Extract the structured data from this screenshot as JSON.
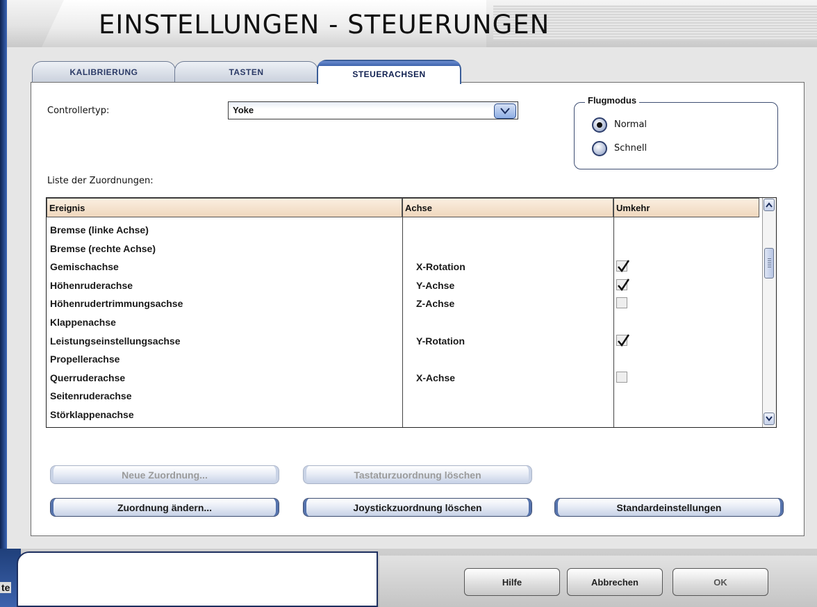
{
  "window": {
    "title": "EINSTELLUNGEN - STEUERUNGEN"
  },
  "tabs": [
    {
      "label": "KALIBRIERUNG",
      "active": false
    },
    {
      "label": "TASTEN",
      "active": false
    },
    {
      "label": "STEUERACHSEN",
      "active": true
    }
  ],
  "controller": {
    "label": "Controllertyp:",
    "value": "Yoke"
  },
  "flugmodus": {
    "title": "Flugmodus",
    "options": [
      {
        "label": "Normal",
        "selected": true
      },
      {
        "label": "Schnell",
        "selected": false
      }
    ]
  },
  "list": {
    "label": "Liste der Zuordnungen:",
    "columns": [
      "Ereignis",
      "Achse",
      "Umkehr"
    ],
    "rows": [
      {
        "event": "Bremse (linke Achse)",
        "axis": "",
        "reverse": null
      },
      {
        "event": "Bremse (rechte Achse)",
        "axis": "",
        "reverse": null
      },
      {
        "event": "Gemischachse",
        "axis": "X-Rotation",
        "reverse": true
      },
      {
        "event": "Höhenruderachse",
        "axis": "Y-Achse",
        "reverse": true
      },
      {
        "event": "Höhenrudertrimmungsachse",
        "axis": "Z-Achse",
        "reverse": false
      },
      {
        "event": "Klappenachse",
        "axis": "",
        "reverse": null
      },
      {
        "event": "Leistungseinstellungsachse",
        "axis": "Y-Rotation",
        "reverse": true
      },
      {
        "event": "Propellerachse",
        "axis": "",
        "reverse": null
      },
      {
        "event": "Querruderachse",
        "axis": "X-Achse",
        "reverse": false
      },
      {
        "event": "Seitenruderachse",
        "axis": "",
        "reverse": null
      },
      {
        "event": "Störklappenachse",
        "axis": "",
        "reverse": null
      }
    ]
  },
  "buttons": {
    "new_mapping": "Neue Zuordnung...",
    "delete_key_mapping": "Tastaturzuordnung löschen",
    "change_mapping": "Zuordnung ändern...",
    "delete_joystick_mapping": "Joystickzuordnung löschen",
    "defaults": "Standardeinstellungen"
  },
  "footer": {
    "help": "Hilfe",
    "cancel": "Abbrechen",
    "ok": "OK"
  },
  "taskbar_fragment": "te"
}
